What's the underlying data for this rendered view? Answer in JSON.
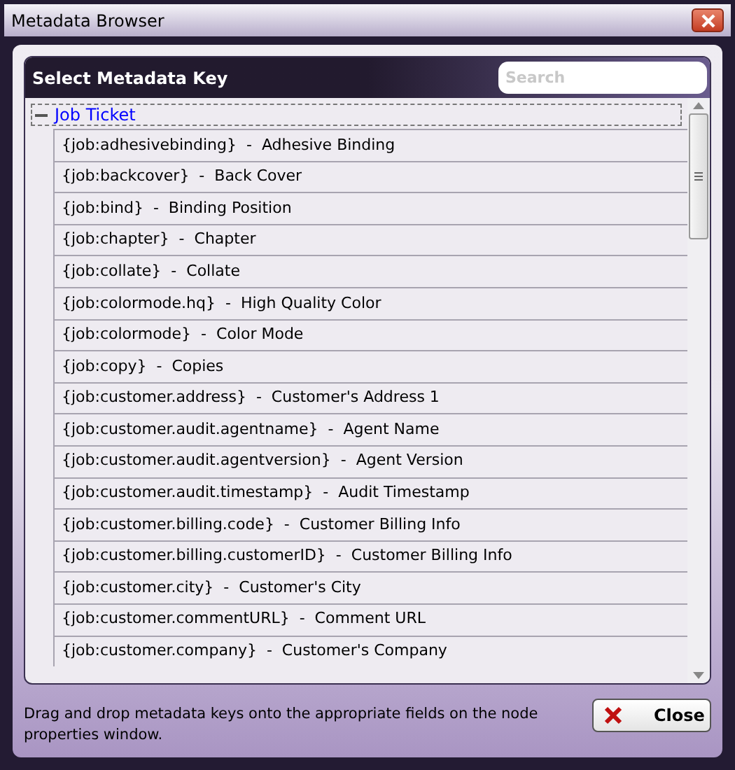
{
  "window": {
    "title": "Metadata Browser"
  },
  "panel": {
    "title": "Select Metadata Key",
    "search": {
      "placeholder": "Search"
    }
  },
  "tree": {
    "label": "Job Ticket",
    "expanded": true,
    "children": [
      {
        "label": "{job:adhesivebinding}  -  Adhesive Binding"
      },
      {
        "label": "{job:backcover}  -  Back Cover"
      },
      {
        "label": "{job:bind}  -  Binding Position"
      },
      {
        "label": "{job:chapter}  -  Chapter"
      },
      {
        "label": "{job:collate}  -  Collate"
      },
      {
        "label": "{job:colormode.hq}  -  High Quality Color"
      },
      {
        "label": "{job:colormode}  -  Color Mode"
      },
      {
        "label": "{job:copy}  -  Copies"
      },
      {
        "label": "{job:customer.address}  -  Customer's Address 1"
      },
      {
        "label": "{job:customer.audit.agentname}  -  Agent Name"
      },
      {
        "label": "{job:customer.audit.agentversion}  -  Agent Version"
      },
      {
        "label": "{job:customer.audit.timestamp}  -  Audit Timestamp"
      },
      {
        "label": "{job:customer.billing.code}  -  Customer Billing Info"
      },
      {
        "label": "{job:customer.billing.customerID}  -  Customer Billing Info"
      },
      {
        "label": "{job:customer.city}  -  Customer's City"
      },
      {
        "label": "{job:customer.commentURL}  -  Comment URL"
      },
      {
        "label": "{job:customer.company}  -  Customer's Company"
      }
    ]
  },
  "footer": {
    "hint": "Drag and drop metadata keys onto the appropriate fields on the node properties window.",
    "close_button": "Close"
  }
}
